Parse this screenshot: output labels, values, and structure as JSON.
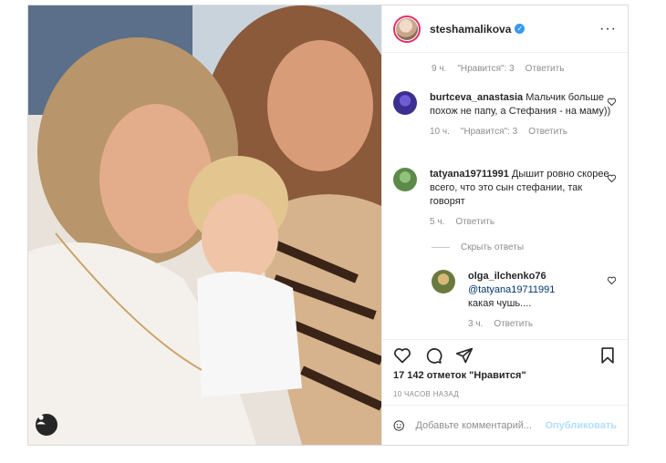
{
  "header": {
    "username": "steshamalikova",
    "verified": true
  },
  "top_meta": {
    "time": "9 ч.",
    "likes": "\"Нравится\": 3",
    "reply": "Ответить"
  },
  "comments": [
    {
      "username": "burtceva_anastasia",
      "text": "Мальчик больше похож не папу, а Стефания - на маму))",
      "time": "10 ч.",
      "likes": "\"Нравится\": 3",
      "reply": "Ответить"
    },
    {
      "username": "tatyana19711991",
      "text": "Дышит ровно скорее всего, что это сын стефании, так говорят",
      "time": "5 ч.",
      "reply": "Ответить"
    }
  ],
  "replies_toggle": "Скрыть ответы",
  "reply": {
    "username": "olga_ilchenko76",
    "mention": "@tatyana19711991",
    "text": "какая чушь....",
    "time": "3 ч.",
    "reply": "Ответить"
  },
  "post": {
    "likes": "17 142 отметок \"Нравится\"",
    "posted_ago": "10 ЧАСОВ НАЗАД"
  },
  "add_comment": {
    "placeholder": "Добавьте комментарий...",
    "publish": "Опубликовать"
  },
  "icons": [
    "heart-icon",
    "comment-icon",
    "share-icon",
    "bookmark-icon",
    "emoji-icon",
    "more-icon",
    "user-tag-icon",
    "verified-icon"
  ],
  "colors": {
    "verified": "#3897f0",
    "mention": "#00376b",
    "publish_disabled": "#b2dffc",
    "muted": "#8e8e8e"
  }
}
